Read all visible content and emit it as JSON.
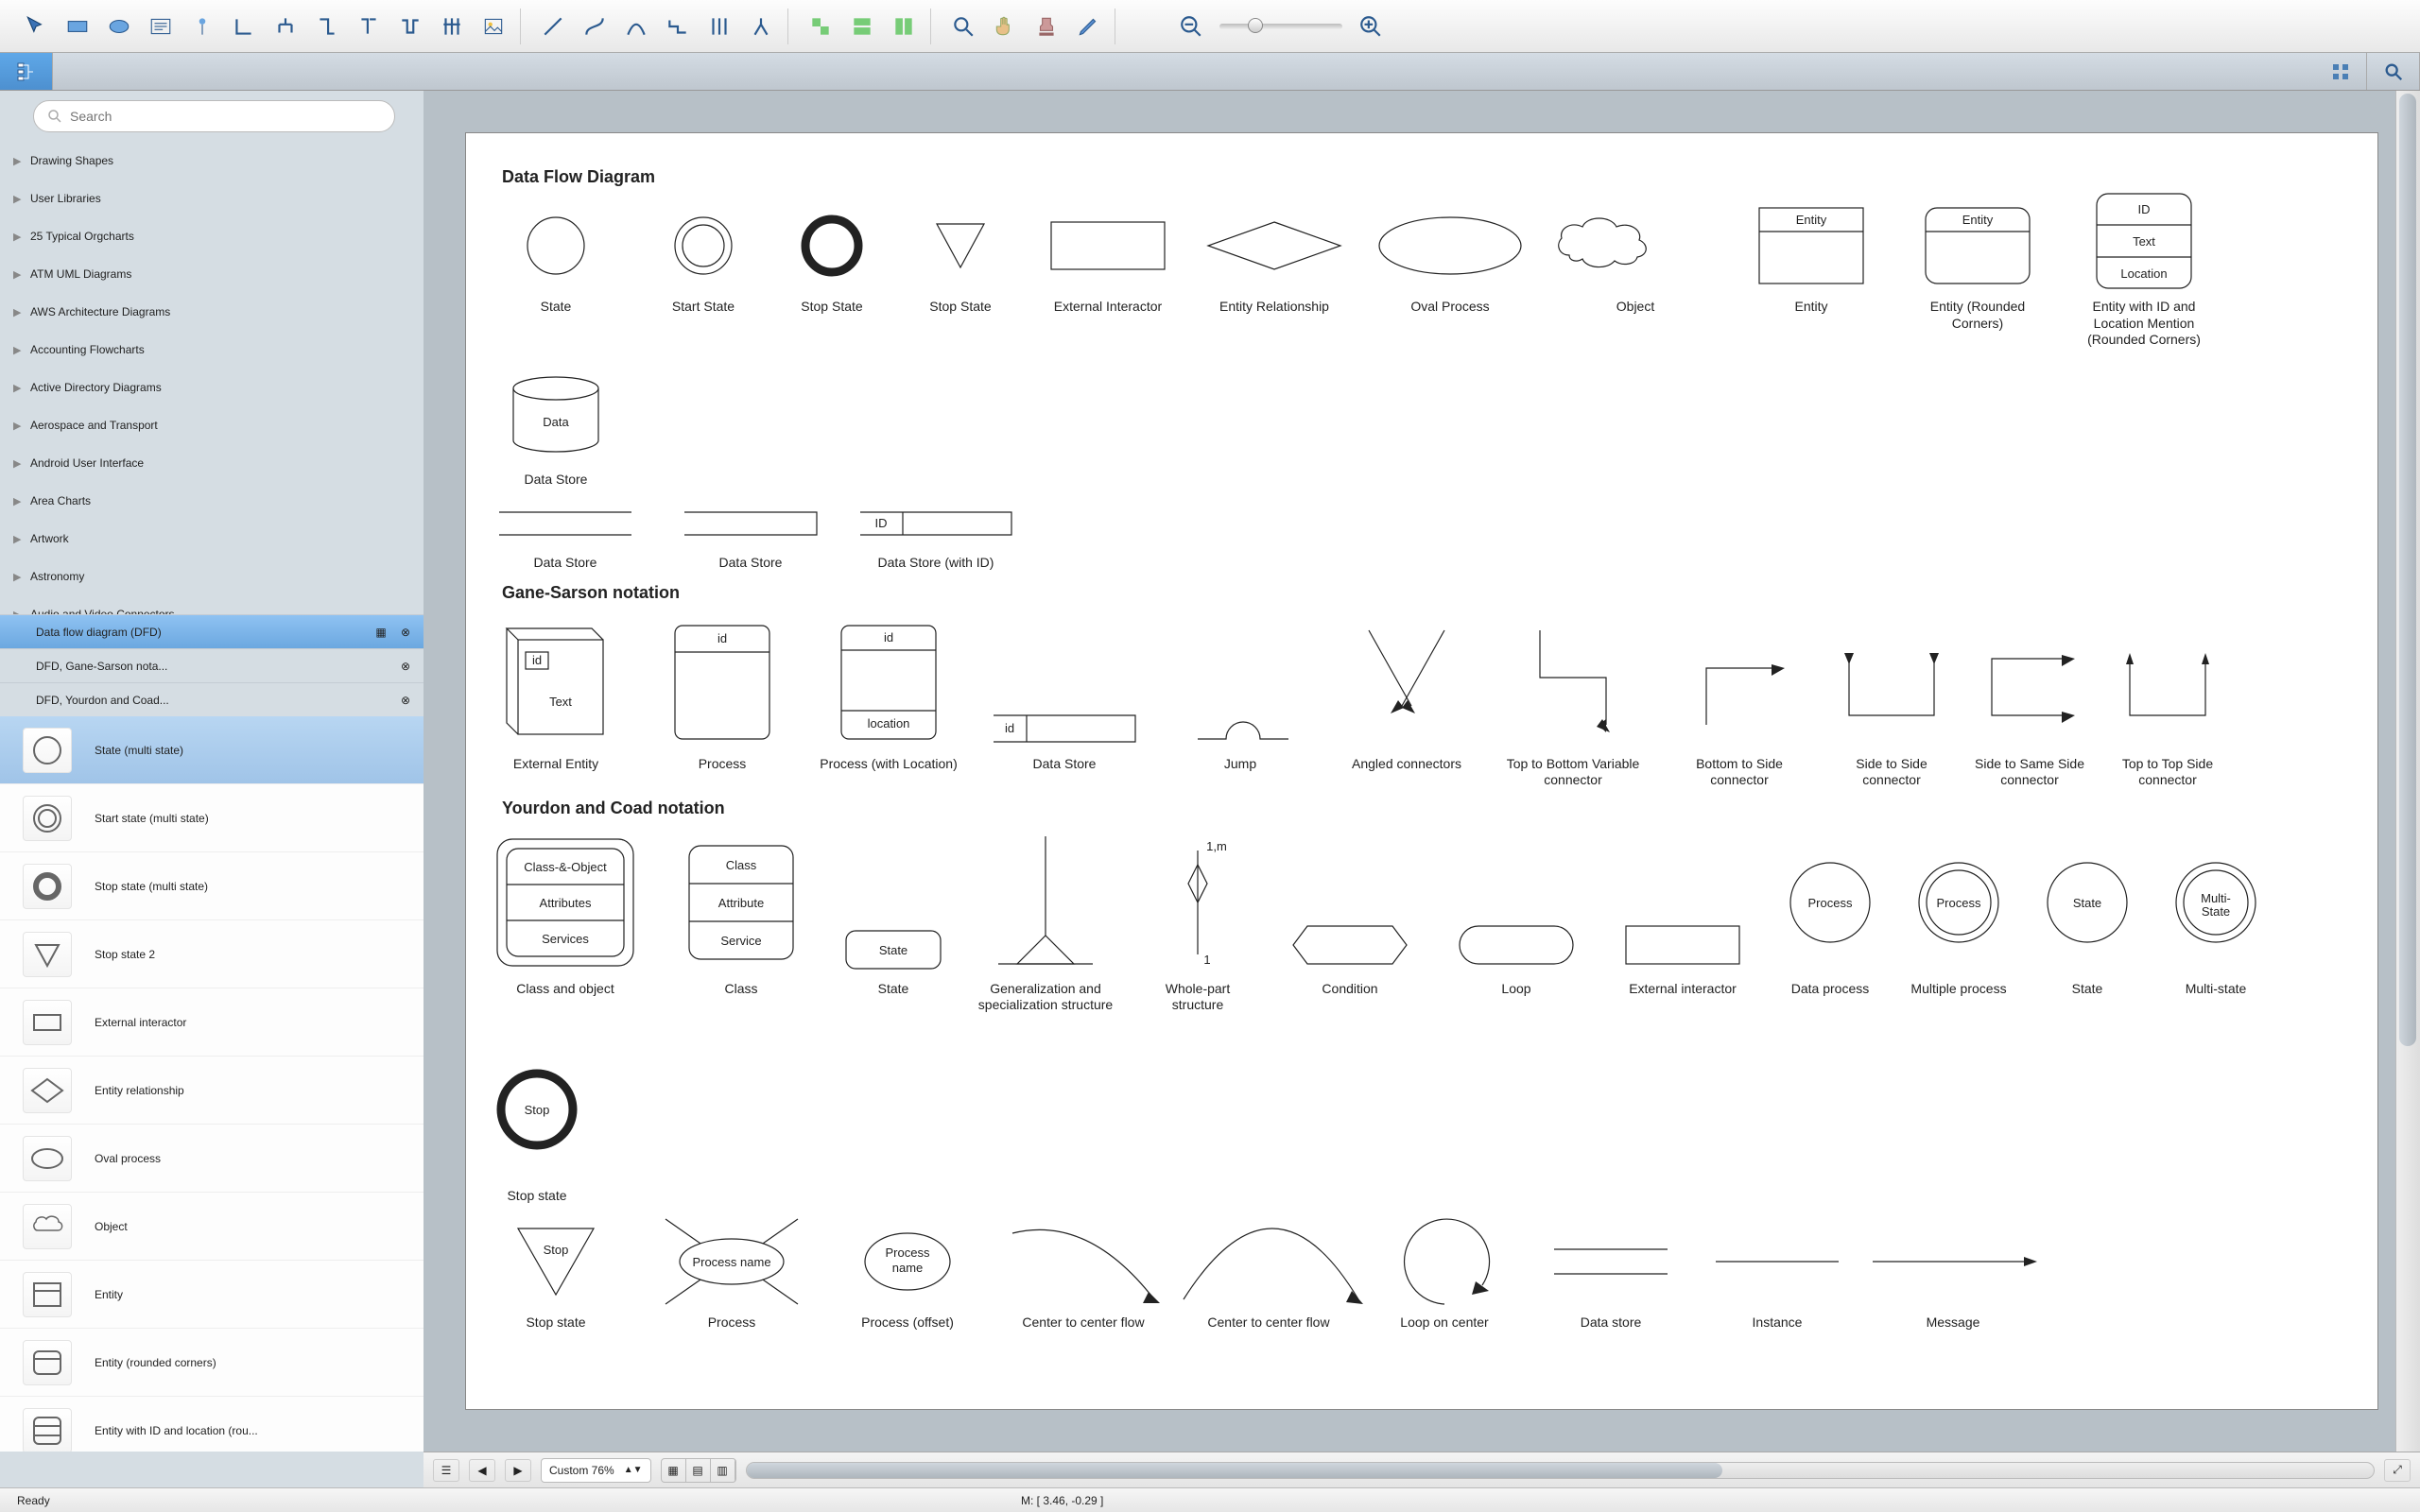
{
  "toolbar_groups": [
    {
      "items": [
        "pointer",
        "rect",
        "ellipse",
        "text",
        "node",
        "conn-l",
        "conn-tree",
        "conn-right",
        "conn-t",
        "conn-m",
        "conn-grid",
        "image"
      ]
    },
    {
      "items": [
        "line",
        "spline",
        "curve",
        "orth",
        "multi",
        "branch"
      ]
    },
    {
      "items": [
        "align1",
        "align2",
        "align3"
      ]
    },
    {
      "items": [
        "zoom-in-sel",
        "hand",
        "person",
        "marker"
      ]
    }
  ],
  "search": {
    "placeholder": "Search"
  },
  "tree_categories": [
    "Drawing Shapes",
    "User Libraries",
    "25 Typical Orgcharts",
    "ATM UML Diagrams",
    "AWS Architecture Diagrams",
    "Accounting Flowcharts",
    "Active Directory Diagrams",
    "Aerospace and Transport",
    "Android User Interface",
    "Area Charts",
    "Artwork",
    "Astronomy",
    "Audio and Video Connectors"
  ],
  "library_tabs": [
    {
      "label": "Data flow diagram (DFD)",
      "active": true,
      "pin": true
    },
    {
      "label": "DFD, Gane-Sarson nota...",
      "active": false
    },
    {
      "label": "DFD, Yourdon and Coad...",
      "active": false
    }
  ],
  "shape_rows": [
    {
      "label": "State (multi state)",
      "icon": "circle",
      "sel": true
    },
    {
      "label": "Start state (multi state)",
      "icon": "double-circle"
    },
    {
      "label": "Stop state (multi state)",
      "icon": "thick-circle"
    },
    {
      "label": "Stop state 2",
      "icon": "triangle"
    },
    {
      "label": "External interactor",
      "icon": "rect"
    },
    {
      "label": "Entity relationship",
      "icon": "diamond"
    },
    {
      "label": "Oval process",
      "icon": "oval"
    },
    {
      "label": "Object",
      "icon": "cloud"
    },
    {
      "label": "Entity",
      "icon": "entity"
    },
    {
      "label": "Entity (rounded corners)",
      "icon": "entity-r"
    },
    {
      "label": "Entity with ID and location (rou...",
      "icon": "entity-3"
    }
  ],
  "canvas": {
    "sec1": {
      "title": "Data Flow Diagram",
      "row1": [
        {
          "label": "State"
        },
        {
          "label": "Start State"
        },
        {
          "label": "Stop State"
        },
        {
          "label": "Stop State"
        },
        {
          "label": "External Interactor"
        },
        {
          "label": "Entity Relationship"
        },
        {
          "label": "Oval Process"
        },
        {
          "label": "Object"
        },
        {
          "label": "Entity",
          "text": "Entity"
        },
        {
          "label": "Entity (Rounded Corners)",
          "text": "Entity"
        },
        {
          "label": "Entity with ID and Location Mention (Rounded Corners)",
          "text": "ID|Text|Location"
        },
        {
          "label": "Data Store",
          "text": "Data"
        }
      ],
      "row2": [
        {
          "label": "Data Store"
        },
        {
          "label": "Data Store"
        },
        {
          "label": "Data Store (with ID)",
          "text": "ID"
        }
      ]
    },
    "sec2": {
      "title": "Gane-Sarson notation",
      "row": [
        {
          "label": "External Entity",
          "text": "id|Text"
        },
        {
          "label": "Process",
          "text": "id"
        },
        {
          "label": "Process (with Location)",
          "text": "id|location"
        },
        {
          "label": "Data Store",
          "text": "id"
        },
        {
          "label": "Jump"
        },
        {
          "label": "Angled connectors"
        },
        {
          "label": "Top to Bottom Variable connector"
        },
        {
          "label": "Bottom to Side connector"
        },
        {
          "label": "Side to Side connector"
        },
        {
          "label": "Side to Same Side connector"
        },
        {
          "label": "Top to Top Side connector"
        }
      ]
    },
    "sec3": {
      "title": "Yourdon and Coad notation",
      "row1": [
        {
          "label": "Class and object",
          "text": "Class-&-Object|Attributes|Services"
        },
        {
          "label": "Class",
          "text": "Class|Attribute|Service"
        },
        {
          "label": "State",
          "text": "State"
        },
        {
          "label": "Generalization and specialization structure"
        },
        {
          "label": "Whole-part structure",
          "text": "1,m|1"
        },
        {
          "label": "Condition"
        },
        {
          "label": "Loop"
        },
        {
          "label": "External interactor"
        },
        {
          "label": "Data process",
          "text": "Process"
        },
        {
          "label": "Multiple process",
          "text": "Process"
        },
        {
          "label": "State",
          "text": "State"
        },
        {
          "label": "Multi-state",
          "text": "Multi-State"
        },
        {
          "label": "Stop state",
          "text": "Stop"
        }
      ],
      "row2": [
        {
          "label": "Stop state",
          "text": "Stop"
        },
        {
          "label": "Process",
          "text": "Process name"
        },
        {
          "label": "Process (offset)",
          "text": "Process name"
        },
        {
          "label": "Center to center flow"
        },
        {
          "label": "Center to center flow"
        },
        {
          "label": "Loop on center"
        },
        {
          "label": "Data store"
        },
        {
          "label": "Instance"
        },
        {
          "label": "Message"
        }
      ]
    }
  },
  "bottom": {
    "zoom": "Custom 76%"
  },
  "status": {
    "ready": "Ready",
    "coord": "M: [ 3.46, -0.29 ]"
  }
}
